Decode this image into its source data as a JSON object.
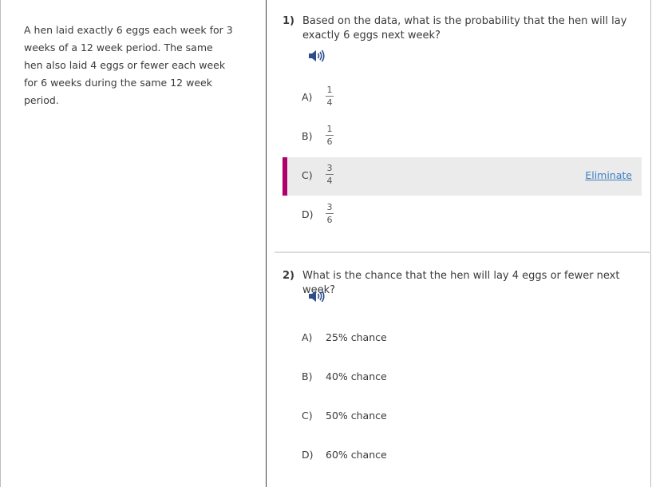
{
  "passage": "A hen laid exactly 6 eggs each week for 3 weeks of a 12 week period. The same hen also laid 4 eggs or fewer each week for 6 weeks during the same 12 week period.",
  "questions": [
    {
      "number": "1)",
      "text": "Based on the data, what is the probability that the hen will lay exactly 6 eggs next week?",
      "speaker_icon": "speaker-icon",
      "options": [
        {
          "letter": "A)",
          "numerator": "1",
          "denominator": "4"
        },
        {
          "letter": "B)",
          "numerator": "1",
          "denominator": "6"
        },
        {
          "letter": "C)",
          "numerator": "3",
          "denominator": "4",
          "selected": true,
          "action": "Eliminate"
        },
        {
          "letter": "D)",
          "numerator": "3",
          "denominator": "6"
        }
      ]
    },
    {
      "number": "2)",
      "text": "What is the chance that the hen will lay 4 eggs or fewer next week?",
      "speaker_icon": "speaker-icon",
      "options": [
        {
          "letter": "A)",
          "text": "25% chance"
        },
        {
          "letter": "B)",
          "text": "40% chance"
        },
        {
          "letter": "C)",
          "text": "50% chance"
        },
        {
          "letter": "D)",
          "text": "60% chance"
        }
      ]
    }
  ],
  "colors": {
    "selection_marker": "#b0006e",
    "selection_bg": "#ebebeb",
    "link": "#3a7fc1",
    "speaker": "#2c4f8a"
  }
}
